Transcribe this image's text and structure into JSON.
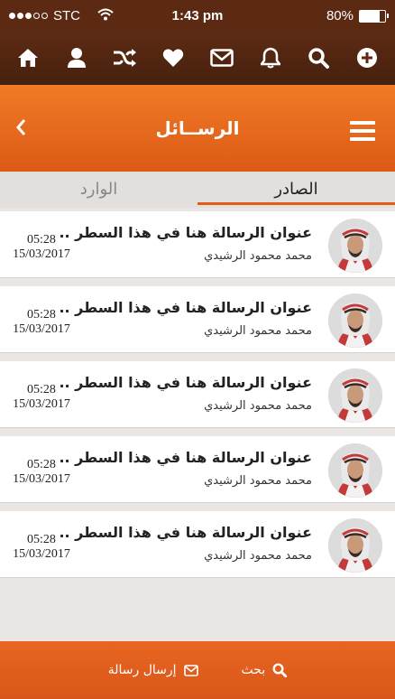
{
  "status": {
    "carrier": "STC",
    "time": "1:43 pm",
    "battery": "80%",
    "battery_level": 0.8,
    "signal_bars": 3
  },
  "toolbar": {
    "icons": [
      "home-icon",
      "user-icon",
      "shuffle-icon",
      "heart-icon",
      "mail-icon",
      "bell-icon",
      "search-icon",
      "add-circle-icon"
    ]
  },
  "header": {
    "title": "الرســائل"
  },
  "tabs": {
    "outgoing": "الصادر",
    "incoming": "الوارد",
    "active": "outgoing"
  },
  "messages": [
    {
      "subject": "عنوان الرسالة هنا في هذا السطر ..",
      "sender": "محمد محمود الرشيدي",
      "time": "05:28",
      "date": "15/03/2017"
    },
    {
      "subject": "عنوان الرسالة هنا في هذا السطر ..",
      "sender": "محمد محمود الرشيدي",
      "time": "05:28",
      "date": "15/03/2017"
    },
    {
      "subject": "عنوان الرسالة هنا في هذا السطر ..",
      "sender": "محمد محمود الرشيدي",
      "time": "05:28",
      "date": "15/03/2017"
    },
    {
      "subject": "عنوان الرسالة هنا في هذا السطر ..",
      "sender": "محمد محمود الرشيدي",
      "time": "05:28",
      "date": "15/03/2017"
    },
    {
      "subject": "عنوان الرسالة هنا في هذا السطر ..",
      "sender": "محمد محمود الرشيدي",
      "time": "05:28",
      "date": "15/03/2017"
    }
  ],
  "bottom": {
    "send_label": "إرسال رسالة",
    "search_label": "بحث"
  },
  "colors": {
    "accent": "#e15d17",
    "toolbar": "#5e2b13"
  }
}
